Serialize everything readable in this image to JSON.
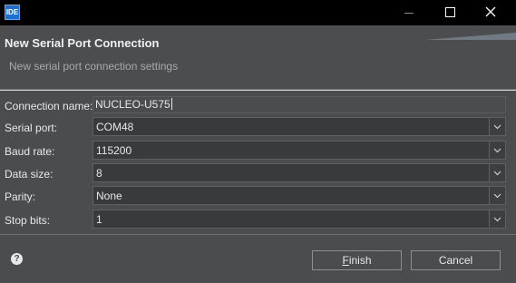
{
  "window": {
    "app_icon_text": "IDE",
    "controls": [
      "minimize-icon",
      "maximize-icon",
      "close-icon"
    ]
  },
  "header": {
    "title": "New Serial Port Connection",
    "subtitle": "New serial port connection settings"
  },
  "form": {
    "connection_name": {
      "label": "Connection name:",
      "value": "NUCLEO-U575"
    },
    "serial_port": {
      "label": "Serial port:",
      "value": "COM48"
    },
    "baud_rate": {
      "label": "Baud rate:",
      "value": "115200"
    },
    "data_size": {
      "label": "Data size:",
      "value": "8"
    },
    "parity": {
      "label": "Parity:",
      "value": "None"
    },
    "stop_bits": {
      "label": "Stop bits:",
      "value": "1"
    }
  },
  "footer": {
    "help_icon": "?",
    "finish_mnemonic": "F",
    "finish_rest": "inish",
    "cancel_label": "Cancel"
  },
  "colors": {
    "background": "#4a4c4e",
    "titlebar": "#000000",
    "combo_background": "#393a3c",
    "text": "#e8e8e8"
  }
}
